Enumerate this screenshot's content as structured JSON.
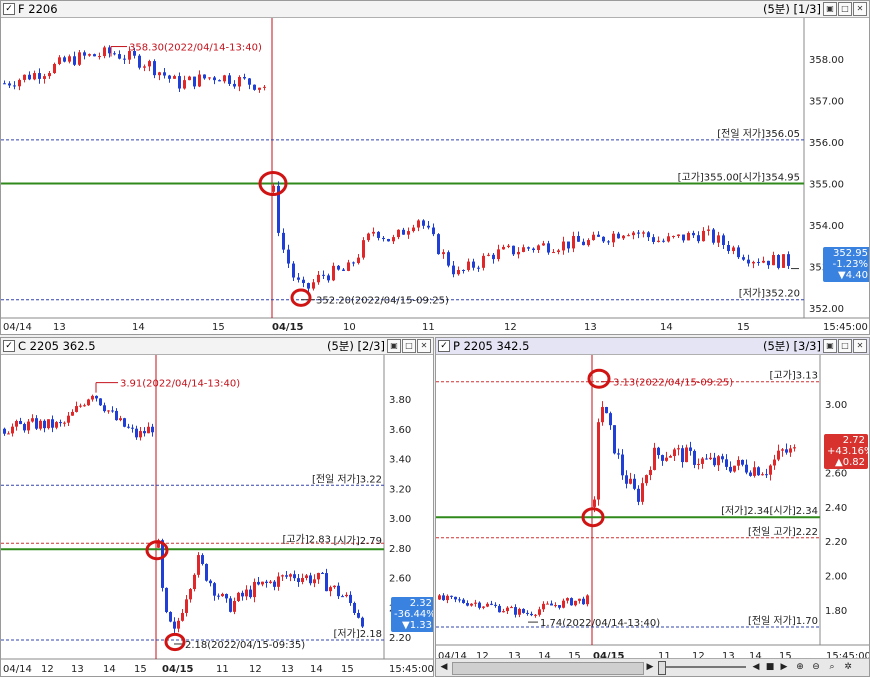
{
  "windows": {
    "f": {
      "title": "F 2206",
      "info": "(5분) [1/3]",
      "price_labels": [
        "358.00",
        "357.00",
        "356.00",
        "355.00",
        "354.00",
        "353.00",
        "352.00"
      ],
      "dates": [
        "04/14",
        "13",
        "14",
        "15",
        "04/15",
        "10",
        "11",
        "12",
        "13",
        "14",
        "15",
        "15:45:00"
      ],
      "annot_high": "358.30(2022/04/14-13:40)",
      "annot_low": "352.20(2022/04/15-09:25)",
      "level_prevlow": "[전일 저가]356.05",
      "level_highopen": "[고가]355.00[시가]354.95",
      "level_low": "[저가]352.20",
      "tag": [
        "352.95",
        "-1.23%",
        "▼4.40"
      ]
    },
    "c": {
      "title": "C 2205 362.5",
      "info": "(5분) [2/3]",
      "price_labels": [
        "3.80",
        "3.60",
        "3.40",
        "3.20",
        "3.00",
        "2.80",
        "2.60",
        "2.40",
        "2.20"
      ],
      "dates": [
        "04/14",
        "12",
        "13",
        "14",
        "15",
        "04/15",
        "11",
        "12",
        "13",
        "14",
        "15",
        "15:45:00"
      ],
      "annot_high": "3.91(2022/04/14-13:40)",
      "annot_low": "2.18(2022/04/15-09:35)",
      "level_prevlow": "[전일 저가]3.22",
      "level_high": "[고가]2.83",
      "level_open": "[시가]2.79",
      "level_low": "[저가]2.18",
      "tag": [
        "2.32",
        "-36.44%",
        "▼1.33"
      ]
    },
    "p": {
      "title": "P 2205 342.5",
      "info": "(5분) [3/3]",
      "price_labels": [
        "3.00",
        "2.80",
        "2.60",
        "2.40",
        "2.20",
        "2.00",
        "1.80"
      ],
      "dates": [
        "04/14",
        "12",
        "13",
        "14",
        "15",
        "04/15",
        "11",
        "12",
        "13",
        "14",
        "15",
        "15:45:00"
      ],
      "annot_high": "3.13(2022/04/15-09:25)",
      "annot_low": "1.74(2022/04/14-13:40)",
      "level_high": "[고가]3.13",
      "level_lowopen": "[저가]2.34[시가]2.34",
      "level_prevhigh": "[전일 고가]2.22",
      "level_prevlow": "[전일 저가]1.70",
      "tag": [
        "2.72",
        "+43.16%",
        "▲0.82"
      ]
    }
  },
  "colors": {
    "up": "#e0282b",
    "down": "#1f3fd6",
    "green": "#2f8a1b",
    "accent_red": "#c4121b",
    "tag_blue": "#3a82e0",
    "tag_red": "#d7322e"
  },
  "icons": [
    "checkbox-icon",
    "restore-icon",
    "maximize-icon",
    "close-icon",
    "scroll-left-icon",
    "scroll-right-icon",
    "zoom-in-icon",
    "zoom-out-icon",
    "search-icon",
    "settings-icon",
    "play-icon",
    "stop-icon"
  ]
}
